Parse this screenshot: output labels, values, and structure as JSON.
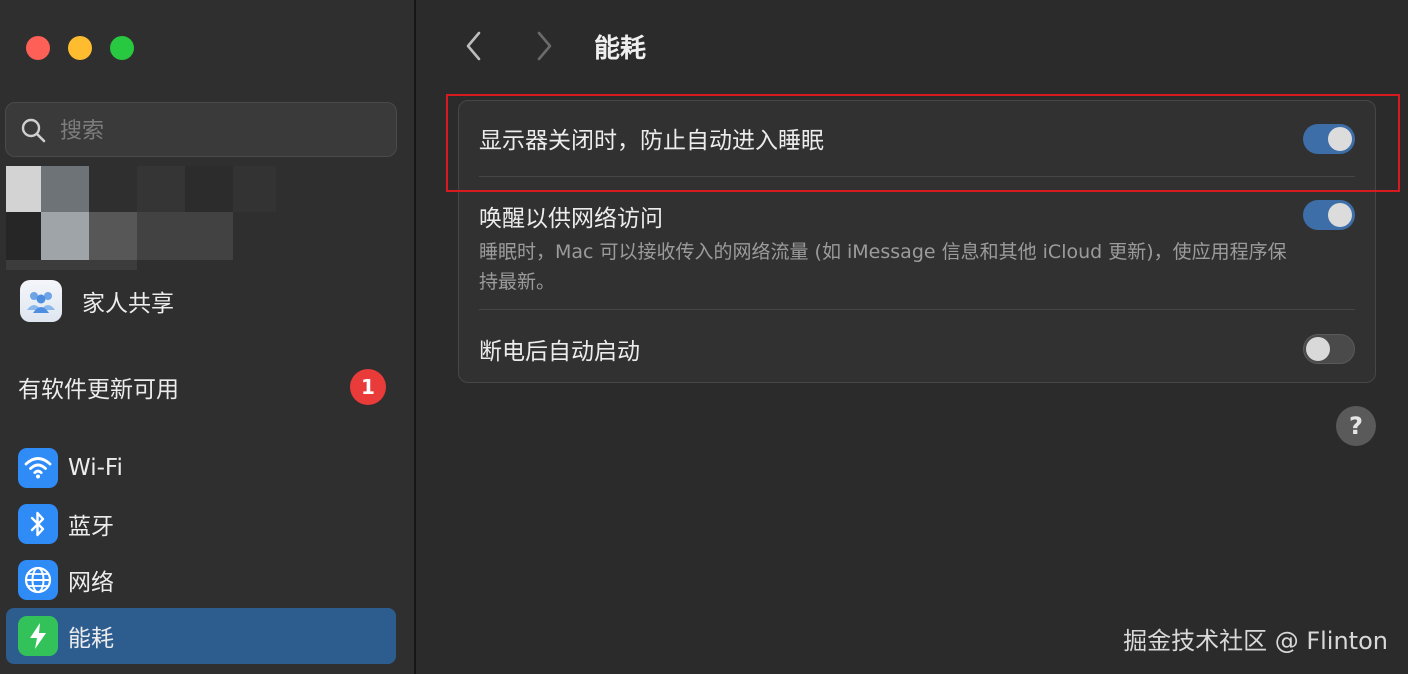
{
  "window": {
    "traffic_lights": [
      "close",
      "minimize",
      "zoom"
    ]
  },
  "sidebar": {
    "search": {
      "placeholder": "搜索",
      "value": ""
    },
    "family": {
      "label": "家人共享",
      "icon": "family-icon"
    },
    "update": {
      "label": "有软件更新可用",
      "badge": "1"
    },
    "items": [
      {
        "label": "Wi-Fi",
        "icon": "wifi-icon",
        "selected": false
      },
      {
        "label": "蓝牙",
        "icon": "bluetooth-icon",
        "selected": false
      },
      {
        "label": "网络",
        "icon": "globe-icon",
        "selected": false
      },
      {
        "label": "能耗",
        "icon": "bolt-icon",
        "selected": true
      }
    ]
  },
  "main": {
    "title": "能耗",
    "settings": [
      {
        "label": "显示器关闭时，防止自动进入睡眠",
        "enabled": true
      },
      {
        "label": "唤醒以供网络访问",
        "description": "睡眠时，Mac 可以接收传入的网络流量 (如 iMessage 信息和其他 iCloud 更新)，使应用程序保持最新。",
        "enabled": true
      },
      {
        "label": "断电后自动启动",
        "enabled": false
      }
    ],
    "help": "?"
  },
  "watermark": "掘金技术社区 @ Flinton",
  "colors": {
    "accent": "#2d5d8f",
    "toggle_on": "#3d6ea8",
    "badge": "#ea3b3b",
    "highlight": "#d71920"
  }
}
